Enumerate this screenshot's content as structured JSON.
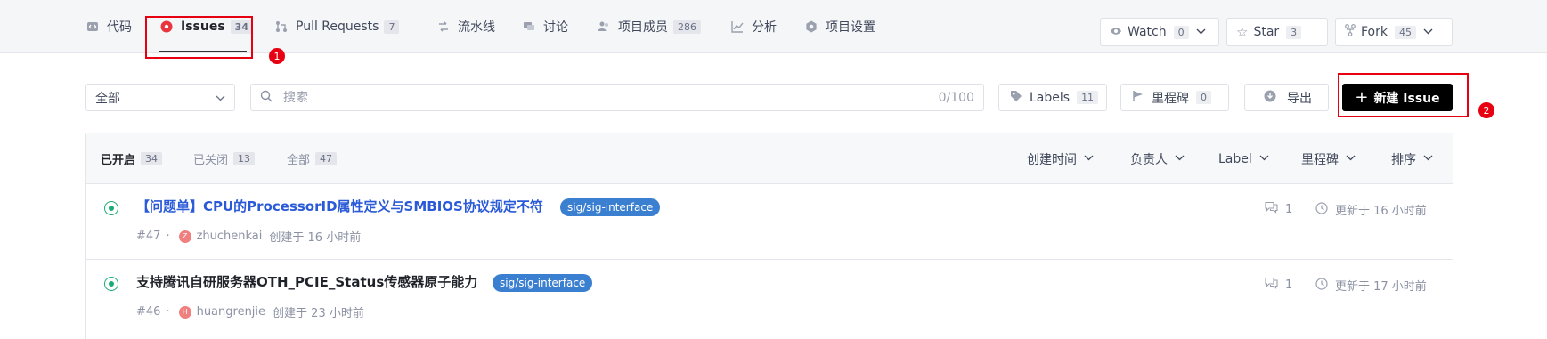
{
  "nav": {
    "tabs": [
      {
        "label": "代码",
        "icon": "code-icon",
        "count": ""
      },
      {
        "label": "Issues",
        "icon": "issue-icon",
        "count": "34"
      },
      {
        "label": "Pull Requests",
        "icon": "pull-request-icon",
        "count": "7"
      },
      {
        "label": "流水线",
        "icon": "pipeline-icon",
        "count": ""
      },
      {
        "label": "讨论",
        "icon": "discussion-icon",
        "count": ""
      },
      {
        "label": "项目成员",
        "icon": "members-icon",
        "count": "286"
      },
      {
        "label": "分析",
        "icon": "chart-icon",
        "count": ""
      },
      {
        "label": "项目设置",
        "icon": "gear-icon",
        "count": ""
      }
    ],
    "watch": {
      "label": "Watch",
      "count": "0"
    },
    "star": {
      "label": "Star",
      "count": "3"
    },
    "fork": {
      "label": "Fork",
      "count": "45"
    }
  },
  "markers": {
    "first": "1",
    "second": "2"
  },
  "filters": {
    "scope": "全部",
    "search_placeholder": "搜索",
    "search_counter": "0/100",
    "labels": {
      "label": "Labels",
      "count": "11"
    },
    "milestone": {
      "label": "里程碑",
      "count": "0"
    },
    "export_label": "导出",
    "new_issue_label": "新建 Issue"
  },
  "list": {
    "states": [
      {
        "label": "已开启",
        "count": "34"
      },
      {
        "label": "已关闭",
        "count": "13"
      },
      {
        "label": "全部",
        "count": "47"
      }
    ],
    "sorts": [
      "创建时间",
      "负责人",
      "Label",
      "里程碑",
      "排序"
    ],
    "issues": [
      {
        "title": "【问题单】CPU的ProcessorID属性定义与SMBIOS协议规定不符",
        "label": "sig/sig-interface",
        "number": "#47",
        "avatar_initial": "Z",
        "author": "zhuchenkai",
        "created": "创建于 16 小时前",
        "comments": "1",
        "updated": "更新于 16 小时前"
      },
      {
        "title": "支持腾讯自研服务器OTH_PCIE_Status传感器原子能力",
        "label": "sig/sig-interface",
        "number": "#46",
        "avatar_initial": "H",
        "author": "huangrenjie",
        "created": "创建于 23 小时前",
        "comments": "1",
        "updated": "更新于 17 小时前"
      }
    ]
  },
  "colors": {
    "accent_red": "#e60012",
    "open_green": "#1aad73",
    "link_blue": "#2a5ad7",
    "label_blue": "#3b7fd0"
  }
}
